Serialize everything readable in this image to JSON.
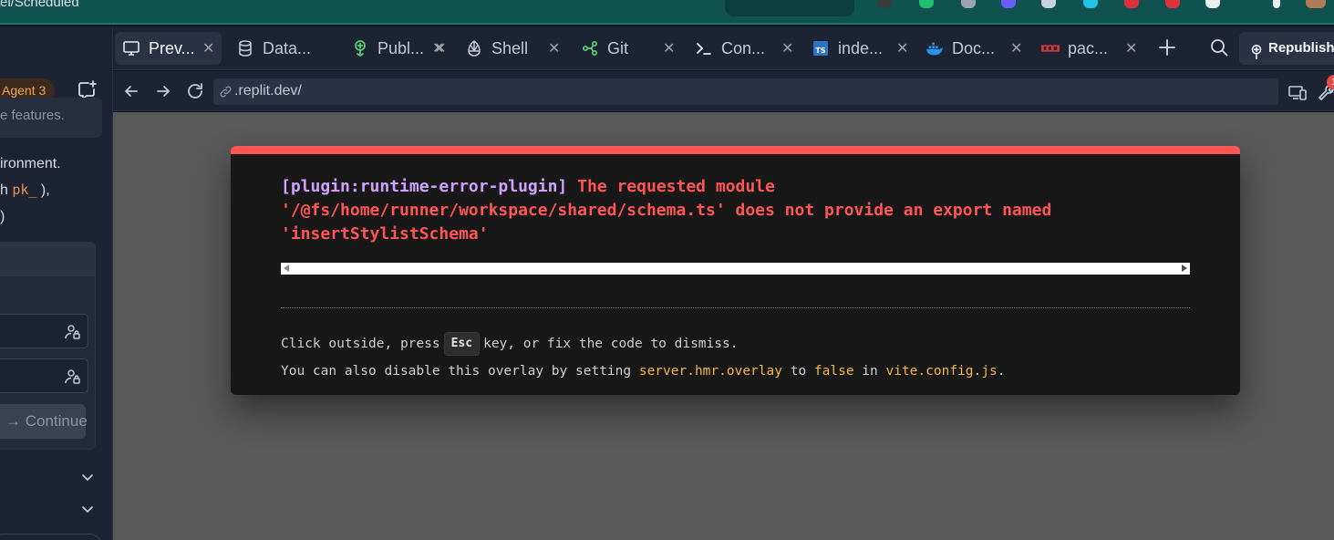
{
  "browser": {
    "url_fragment": "el/Scheduled"
  },
  "left_panel": {
    "agent_badge": "Agent 3",
    "faded_text": "e features.",
    "message_lines": [
      {
        "before": "ironment.",
        "code": "",
        "after": ""
      },
      {
        "before": "h ",
        "code": "pk_",
        "after": " ),"
      },
      {
        "before": ")",
        "code": "",
        "after": ""
      }
    ],
    "continue_label": "Continue"
  },
  "tabs": [
    {
      "label": "Prev...",
      "icon": "monitor-icon",
      "active": true
    },
    {
      "label": "Data...",
      "icon": "database-icon",
      "active": false
    },
    {
      "label": "Publ...",
      "icon": "publish-icon",
      "active": false
    },
    {
      "label": "Shell",
      "icon": "shell-icon",
      "active": false
    },
    {
      "label": "Git",
      "icon": "git-icon",
      "active": false
    },
    {
      "label": "Con...",
      "icon": "console-icon",
      "active": false
    },
    {
      "label": "inde...",
      "icon": "typescript-icon",
      "active": false
    },
    {
      "label": "Doc...",
      "icon": "docker-icon",
      "active": false
    },
    {
      "label": "pac...",
      "icon": "package-icon",
      "active": false
    }
  ],
  "toolbar": {
    "republish_label": "Republish",
    "notification_count": "1"
  },
  "address_bar": {
    "url": ".replit.dev/"
  },
  "error_overlay": {
    "plugin": "[plugin:runtime-error-plugin]",
    "message": " The requested module\n'/@fs/home/runner/workspace/shared/schema.ts' does not provide an export named\n'insertStylistSchema'",
    "tip1_before": "Click outside, press",
    "tip1_key": "Esc",
    "tip1_after": "key, or fix the code to dismiss.",
    "tip2_a": "You can also disable this overlay by setting ",
    "tip2_config_key": "server.hmr.overlay",
    "tip2_b": " to ",
    "tip2_value": "false",
    "tip2_c": " in ",
    "tip2_file": "vite.config.js",
    "tip2_d": "."
  },
  "colors": {
    "error_accent": "#ff5555",
    "plugin_text": "#cfa0ff",
    "highlight": "#f5b642",
    "agent_badge": "#f0a35e"
  }
}
